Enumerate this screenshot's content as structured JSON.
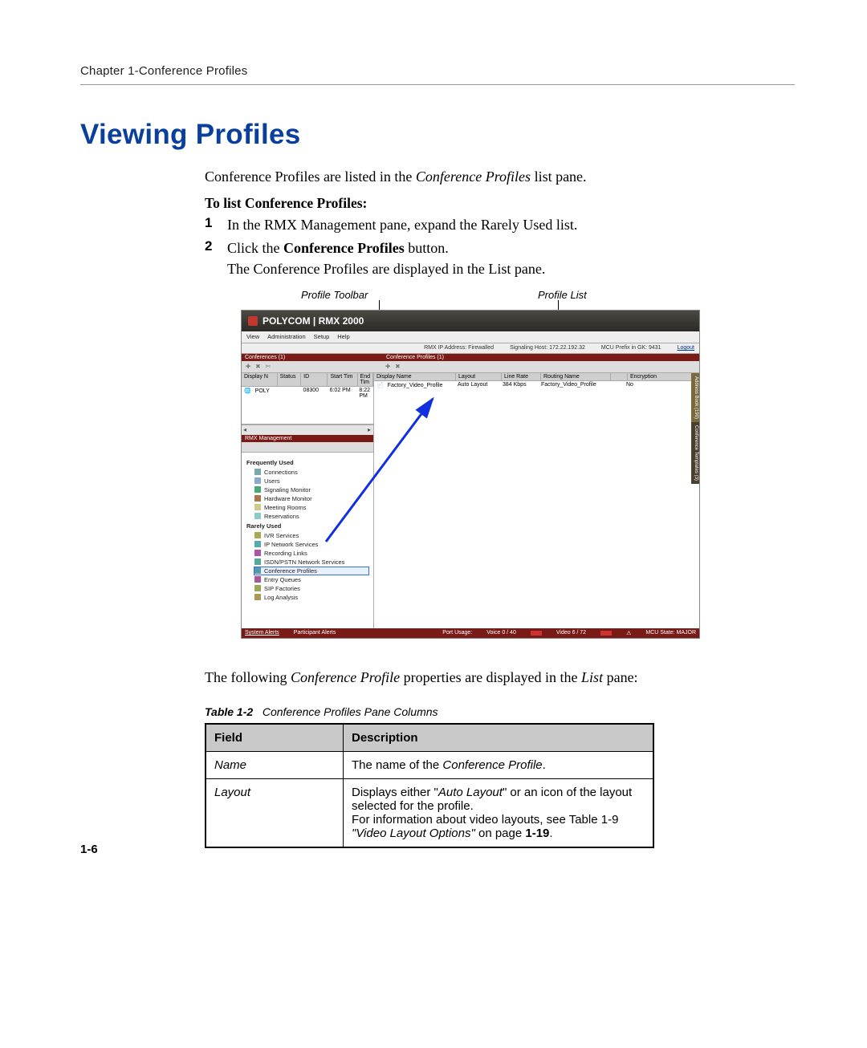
{
  "header": {
    "breadcrumb": "Chapter 1-Conference Profiles"
  },
  "title": "Viewing Profiles",
  "intro": {
    "prefix": "Conference Profiles are listed in the ",
    "ital": "Conference Profiles",
    "suffix": " list pane."
  },
  "steps_heading": "To list Conference Profiles:",
  "steps": [
    {
      "num": "1",
      "parts": [
        "In the ",
        "RMX Management",
        " pane, expand the ",
        "Rarely Used",
        " list."
      ]
    },
    {
      "num": "2",
      "parts": [
        "Click the ",
        "Conference Profiles",
        " button."
      ]
    }
  ],
  "step_result": {
    "prefix": "The ",
    "ital1": "Conference Profiles",
    "mid": " are displayed in the ",
    "ital2": "List",
    "suffix": " pane."
  },
  "callouts": {
    "left": "Profile Toolbar",
    "right": "Profile List"
  },
  "screenshot": {
    "banner": "POLYCOM | RMX 2000",
    "menu": [
      "View",
      "Administration",
      "Setup",
      "Help"
    ],
    "info": [
      "RMX IP Address: Firewalled",
      "Signaling Host: 172.22.192.32",
      "MCU Prefix in GK: 9431",
      "Logout"
    ],
    "left_panel_title": "Conferences (1)",
    "right_panel_title": "Conference Profiles (1)",
    "conf_columns": [
      "Display N",
      "Status",
      "ID",
      "Start Tim",
      "End Tim"
    ],
    "conf_row": [
      "POLY",
      "",
      "08300",
      "6:02 PM",
      "8:22 PM"
    ],
    "rmx_mgmt_title": "RMX Management",
    "nav_groups": {
      "freq_label": "Frequently Used",
      "freq_items": [
        "Connections",
        "Users",
        "Signaling Monitor",
        "Hardware Monitor",
        "Meeting Rooms",
        "Reservations"
      ],
      "rare_label": "Rarely Used",
      "rare_items": [
        "IVR Services",
        "IP Network Services",
        "Recording Links",
        "ISDN/PSTN Network Services",
        "Conference Profiles",
        "Entry Queues",
        "SIP Factories",
        "Log Analysis"
      ]
    },
    "profile_columns": [
      "Display Name",
      "Layout",
      "Line Rate",
      "Routing Name",
      "",
      "Encryption"
    ],
    "profile_row": [
      "Factory_Video_Profile",
      "Auto Layout",
      "384 Kbps",
      "Factory_Video_Profile",
      "",
      "No"
    ],
    "right_tabs": [
      "Address Book (190)",
      "Conference Templates (3)"
    ],
    "status_left": [
      "System Alerts",
      "Participant Alerts"
    ],
    "status_right": {
      "port_label": "Port Usage:",
      "voice": "Voice    0 / 40",
      "video": "Video    6 / 72",
      "mcu": "MCU State: MAJOR"
    }
  },
  "after_fig": {
    "prefix": "The following ",
    "ital": "Conference Profile",
    "mid": " properties are displayed in the ",
    "ital2": "List",
    "suffix": " pane:"
  },
  "table": {
    "caption_bold": "Table 1-2",
    "caption_rest": "Conference Profiles Pane Columns",
    "head": [
      "Field",
      "Description"
    ],
    "rows": [
      {
        "field": "Name",
        "desc_prefix": "The name of the ",
        "desc_ital": "Conference Profile",
        "desc_suffix": "."
      },
      {
        "field": "Layout",
        "line1_pre": "Displays either \"",
        "line1_ital": "Auto Layout",
        "line1_post": "\" or an icon of the layout selected for the profile.",
        "line2": "For information about video layouts, see Table 1-9 ",
        "line2_ital": "\"Video Layout Options\"",
        "line2_post": " on page ",
        "line2_bold": "1-19",
        "line2_end": "."
      }
    ]
  },
  "page_number": "1-6"
}
